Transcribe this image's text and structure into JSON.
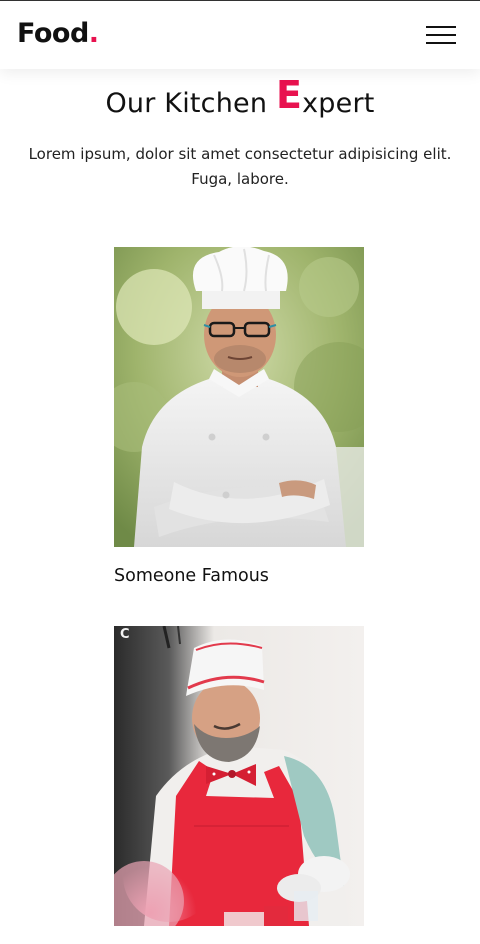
{
  "header": {
    "logo_text": "Food",
    "logo_dot": ".",
    "menu_icon": "hamburger-menu-icon"
  },
  "section": {
    "title_before": "Our Kitchen ",
    "title_highlight": "E",
    "title_after": "xpert",
    "description": "Lorem ipsum, dolor sit amet consectetur adipisicing elit. Fuga, labore."
  },
  "experts": [
    {
      "name": "Someone Famous"
    },
    {
      "name": ""
    }
  ],
  "colors": {
    "accent": "#e8124f",
    "text": "#111111",
    "background": "#ffffff"
  }
}
